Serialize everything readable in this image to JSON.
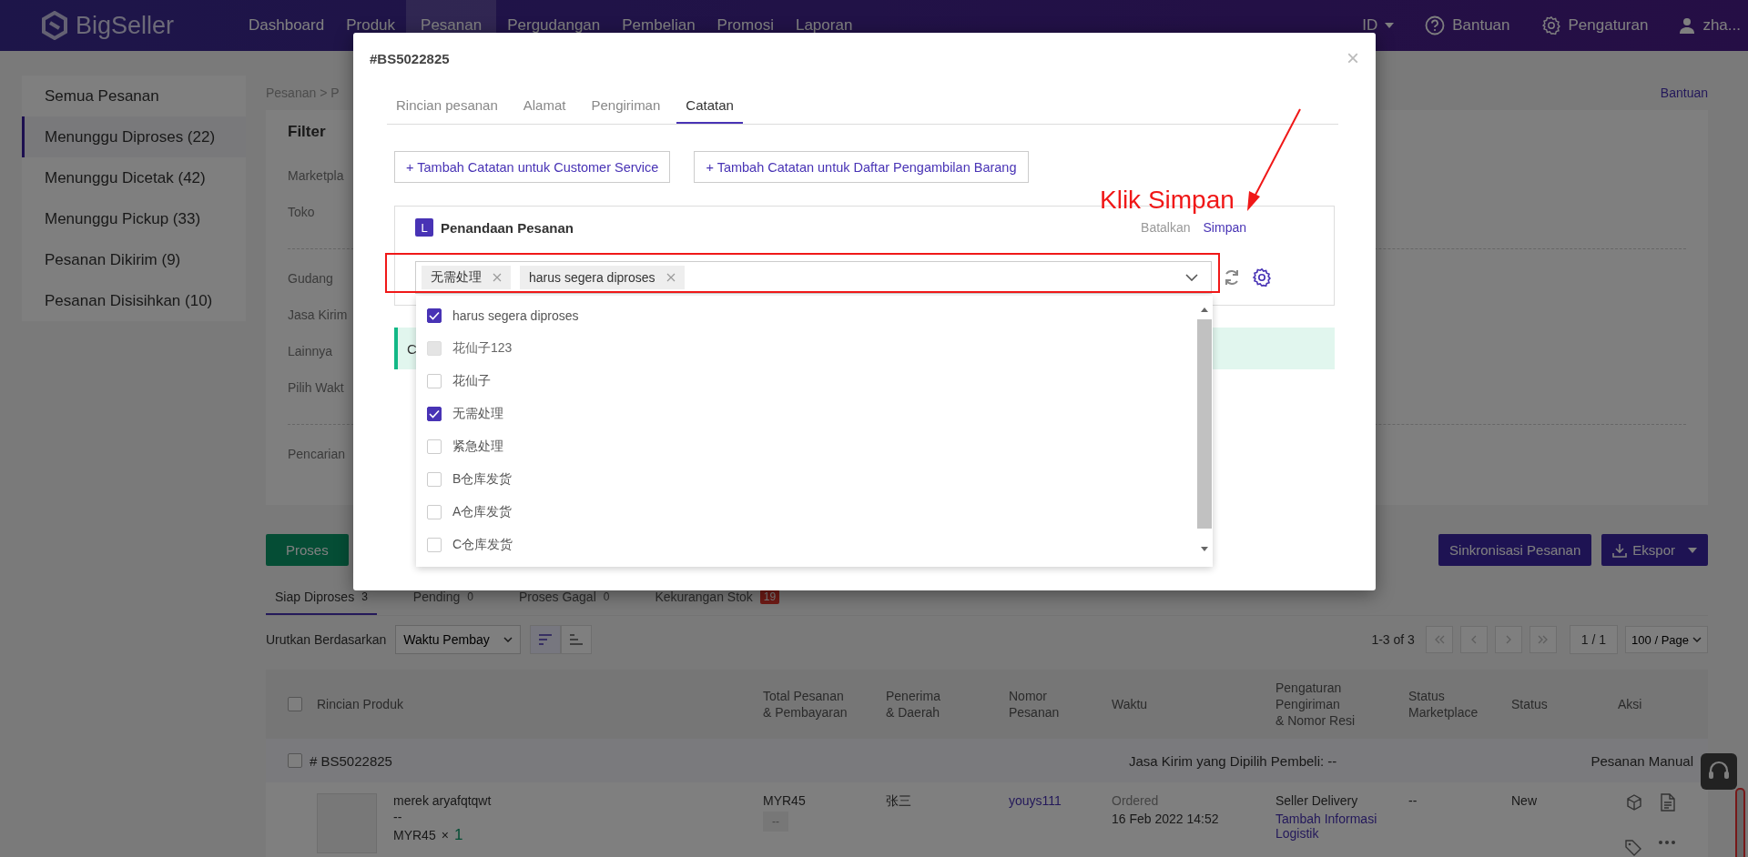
{
  "nav": {
    "logo": "BigSeller",
    "menu": [
      {
        "label": "Dashboard",
        "selected": false
      },
      {
        "label": "Produk",
        "selected": false
      },
      {
        "label": "Pesanan",
        "selected": true
      },
      {
        "label": "Pergudangan",
        "selected": false
      },
      {
        "label": "Pembelian",
        "selected": false
      },
      {
        "label": "Promosi",
        "selected": false
      },
      {
        "label": "Laporan",
        "selected": false
      }
    ],
    "language": "ID",
    "help": "Bantuan",
    "settings": "Pengaturan",
    "user": "zha..."
  },
  "sidebar": {
    "items": [
      {
        "label": "Semua Pesanan",
        "selected": false
      },
      {
        "label": "Menunggu Diproses (22)",
        "selected": true
      },
      {
        "label": "Menunggu Dicetak (42)",
        "selected": false
      },
      {
        "label": "Menunggu Pickup (33)",
        "selected": false
      },
      {
        "label": "Pesanan Dikirim (9)",
        "selected": false
      },
      {
        "label": "Pesanan Disisihkan (10)",
        "selected": false
      }
    ]
  },
  "breadcrumb": "Pesanan > P",
  "help_link": "Bantuan",
  "filter": {
    "title": "Filter",
    "groups": [
      [
        "Marketpla",
        "Toko"
      ],
      [
        "Gudang",
        "Jasa Kirim",
        "Lainnya",
        "Pilih Wakt"
      ],
      [
        "Pencarian"
      ]
    ]
  },
  "actions": {
    "process": "Proses",
    "sync": "Sinkronisasi Pesanan",
    "export": "Ekspor"
  },
  "status_tabs": [
    {
      "label": "Siap Diproses",
      "count": "3",
      "kind": "plain",
      "selected": true
    },
    {
      "label": "Pending",
      "count": "0",
      "kind": "plain",
      "selected": false
    },
    {
      "label": "Proses Gagal",
      "count": "0",
      "kind": "plain",
      "selected": false
    },
    {
      "label": "Kekurangan Stok",
      "count": "19",
      "kind": "alert",
      "selected": false
    }
  ],
  "sort": {
    "label": "Urutkan Berdasarkan",
    "value": "Waktu Pembay"
  },
  "pagination": {
    "summary": "1-3 of 3",
    "page": "1 / 1",
    "page_size": "100 / Page"
  },
  "table": {
    "select_all_checked": false,
    "columns": [
      "Rincian Produk",
      "Total Pesanan\n& Pembayaran",
      "Penerima\n& Daerah",
      "Nomor\nPesanan",
      "Waktu",
      "Pengaturan\nPengiriman\n& Nomor Resi",
      "Status\nMarketplace",
      "Status",
      "Aksi"
    ],
    "orders": [
      {
        "checked": false,
        "number": "# BS5022825",
        "courier": "Jasa Kirim yang Dipilih Pembeli: --",
        "type": "Pesanan Manual",
        "items": [
          {
            "product": "merek aryafqtqwt",
            "variant": "--",
            "price": "MYR45",
            "multiplier": "×",
            "quantity": "1",
            "total": "MYR45",
            "payment": "--",
            "recipient": "张三",
            "order_no": "youys111",
            "time_status": "Ordered",
            "time": "16 Feb 2022 14:52",
            "shipping": "Seller Delivery",
            "shipping_link": "Tambah Informasi Logistik",
            "marketplace_status": "--",
            "status": "New"
          }
        ]
      }
    ]
  },
  "modal": {
    "title": "#BS5022825",
    "close": "×",
    "tabs": [
      {
        "label": "Rincian pesanan",
        "selected": false
      },
      {
        "label": "Alamat",
        "selected": false
      },
      {
        "label": "Pengiriman",
        "selected": false
      },
      {
        "label": "Catatan",
        "selected": true
      }
    ],
    "add_buttons": [
      "+ Tambah Catatan untuk Customer Service",
      "+ Tambah Catatan untuk Daftar Pengambilan Barang"
    ],
    "tag_card": {
      "badge": "L",
      "title": "Penandaan Pesanan",
      "cancel": "Batalkan",
      "save": "Simpan",
      "tags": [
        "无需处理",
        "harus segera diproses"
      ]
    },
    "options": [
      {
        "label": "harus segera diproses",
        "checked": true,
        "disabled": false
      },
      {
        "label": "花仙子123",
        "checked": false,
        "disabled": true
      },
      {
        "label": "花仙子",
        "checked": false,
        "disabled": false
      },
      {
        "label": "无需处理",
        "checked": true,
        "disabled": false
      },
      {
        "label": "紧急处理",
        "checked": false,
        "disabled": false
      },
      {
        "label": "B仓库发货",
        "checked": false,
        "disabled": false
      },
      {
        "label": "A仓库发货",
        "checked": false,
        "disabled": false
      },
      {
        "label": "C仓库发货",
        "checked": false,
        "disabled": false
      }
    ],
    "note": "C"
  },
  "annotation": {
    "text": "Klik Simpan"
  }
}
